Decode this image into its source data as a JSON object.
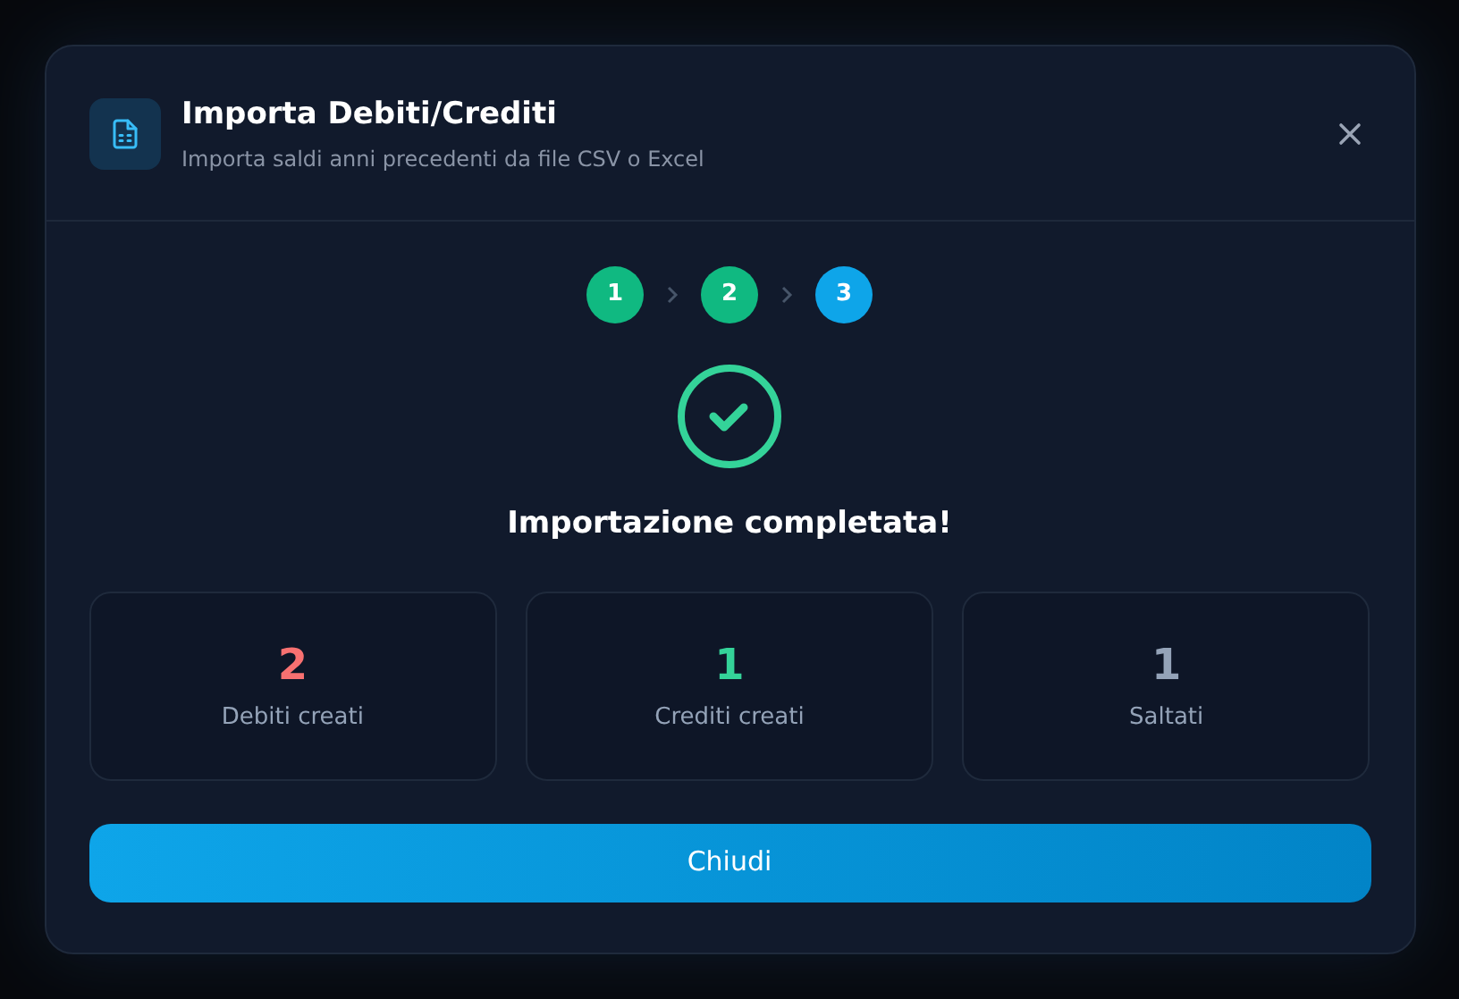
{
  "dialog": {
    "title": "Importa Debiti/Crediti",
    "subtitle": "Importa saldi anni precedenti da file CSV o Excel"
  },
  "steps": [
    {
      "label": "1",
      "done": true,
      "selected": false
    },
    {
      "label": "2",
      "done": true,
      "selected": false
    },
    {
      "label": "3",
      "done": false,
      "selected": true
    }
  ],
  "result": {
    "title": "Importazione completata!"
  },
  "stats": [
    {
      "value": "2",
      "label": "Debiti creati",
      "color": "#f87171"
    },
    {
      "value": "1",
      "label": "Crediti creati",
      "color": "#34d399"
    },
    {
      "value": "1",
      "label": "Saltati",
      "color": "#94a3b8"
    }
  ],
  "close_button": "Chiudi"
}
